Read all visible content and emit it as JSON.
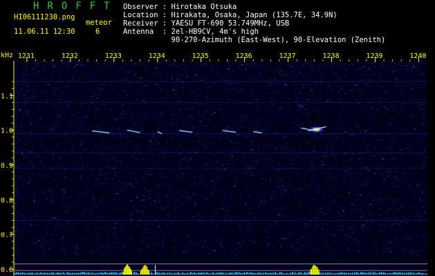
{
  "header": {
    "brand": "HROFFT",
    "filename": "HI06111230.png",
    "timestamp": "11.06.11 12:30",
    "meteor_label": "meteor",
    "meteor_count": "6",
    "observer": "Observer : Hirotaka Otsuka",
    "location": "Location : Hirakata, Osaka, Japan (135.7E, 34.9N)",
    "receiver": "Receiver : YAESU FT-690 53.749MHz, USB",
    "antenna": "Antenna  : 2el-HB9CV, 4m's high",
    "antenna2": "           90-270-Azimuth (East-West), 90-Elevation (Zenith)"
  },
  "colors": {
    "background": "#000000",
    "plot_bg": "#00001c",
    "axis_text": "#ffff00",
    "header_text": "#ffffff",
    "brand": "#2ecc40",
    "echo": "#7fd0ff",
    "spectrum": "#29b6f6",
    "spectrum_peak": "#ffff00"
  },
  "chart_data": {
    "type": "heatmap",
    "ylabel": "kHz",
    "x_ticks": [
      "1231",
      "1232",
      "1233",
      "1234",
      "1235",
      "1236",
      "1237",
      "1238",
      "1239",
      "1240"
    ],
    "y_ticks": [
      "1.1",
      "1.0",
      "0.9",
      "0.8",
      "0.7",
      "0.6"
    ],
    "xlim": [
      1230.7,
      1240.2
    ],
    "ylim": [
      0.58,
      1.2
    ],
    "grid": true,
    "meteor_echoes": [
      {
        "x0": 1232.5,
        "x1": 1232.9,
        "y0": 0.998,
        "y1": 0.992
      },
      {
        "x0": 1233.3,
        "x1": 1233.6,
        "y0": 1.0,
        "y1": 0.993
      },
      {
        "x0": 1234.0,
        "x1": 1234.1,
        "y0": 0.995,
        "y1": 0.99
      },
      {
        "x0": 1234.5,
        "x1": 1234.8,
        "y0": 0.999,
        "y1": 0.994
      },
      {
        "x0": 1235.5,
        "x1": 1235.8,
        "y0": 0.999,
        "y1": 0.994
      },
      {
        "x0": 1236.2,
        "x1": 1236.4,
        "y0": 0.996,
        "y1": 0.992
      },
      {
        "x0": 1237.3,
        "x1": 1237.7,
        "y0": 1.006,
        "y1": 0.997
      }
    ],
    "strong_echo": {
      "x": 1237.65,
      "y": 1.002
    },
    "spectrum_peaks": [
      1233.3,
      1233.7,
      1237.6
    ]
  }
}
